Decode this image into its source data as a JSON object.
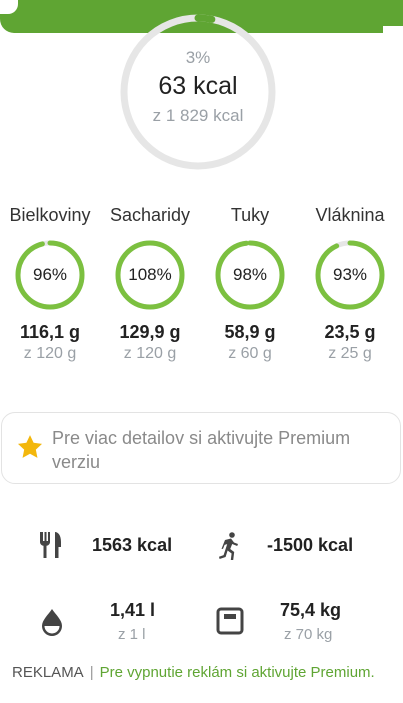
{
  "colors": {
    "accent": "#5fa533",
    "ring_track": "#e6e6e6",
    "muted": "#9aa0a6",
    "star": "#f3b70c"
  },
  "calories": {
    "percent": "3%",
    "value": "63 kcal",
    "goal": "z 1 829 kcal",
    "progress": 0.03
  },
  "macros": [
    {
      "label": "Bielkoviny",
      "percent": "96%",
      "value": "116,1 g",
      "goal": "z 120 g",
      "progress": 0.96
    },
    {
      "label": "Sacharidy",
      "percent": "108%",
      "value": "129,9 g",
      "goal": "z 120 g",
      "progress": 1.0
    },
    {
      "label": "Tuky",
      "percent": "98%",
      "value": "58,9 g",
      "goal": "z 60 g",
      "progress": 0.98
    },
    {
      "label": "Vláknina",
      "percent": "93%",
      "value": "23,5 g",
      "goal": "z 25 g",
      "progress": 0.93
    }
  ],
  "premium": {
    "text": "Pre viac detailov si aktivujte Premium verziu",
    "icon": "star-icon"
  },
  "stats": {
    "food": {
      "icon": "fork-knife-icon",
      "value": "1563 kcal"
    },
    "exercise": {
      "icon": "running-icon",
      "value": "-1500 kcal"
    },
    "water": {
      "icon": "water-drop-icon",
      "value": "1,41 l",
      "goal": "z 1 l"
    },
    "weight": {
      "icon": "scale-icon",
      "value": "75,4 kg",
      "goal": "z 70 kg"
    }
  },
  "footer": {
    "ad_label": "REKLAMA",
    "separator": "|",
    "link": "Pre vypnutie reklám si aktivujte Premium."
  }
}
